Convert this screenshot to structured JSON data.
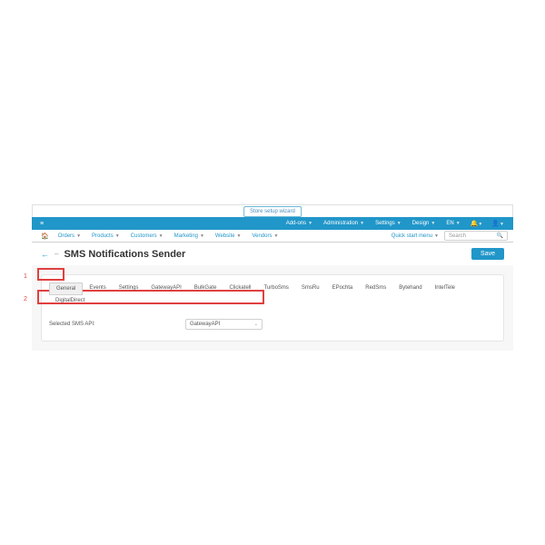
{
  "setup_wizard": "Store setup wizard",
  "top_nav": {
    "addons": "Add-ons",
    "administration": "Administration",
    "settings": "Settings",
    "design": "Design",
    "lang": "EN"
  },
  "menu": {
    "orders": "Orders",
    "products": "Products",
    "customers": "Customers",
    "marketing": "Marketing",
    "website": "Website",
    "vendors": "Vendors",
    "quick_start": "Quick start menu"
  },
  "search_placeholder": "Search",
  "page": {
    "title": "SMS Notifications Sender",
    "save": "Save"
  },
  "tabs": {
    "general": "General",
    "events": "Events",
    "settings": "Settings",
    "gatewayapi": "GatewayAPI",
    "bulkgate": "BulkGate",
    "clickatell": "Clickatell",
    "turbosms": "TurboSms",
    "smsru": "SmsRu",
    "epochta": "EPochta",
    "redsms": "RedSms",
    "bytehand": "Bytehand",
    "inteltele": "IntelTele",
    "digitaldirect": "DigitalDirect"
  },
  "field": {
    "label": "Selected SMS API:",
    "value": "GatewayAPI"
  },
  "annotations": {
    "one": "1",
    "two": "2"
  }
}
